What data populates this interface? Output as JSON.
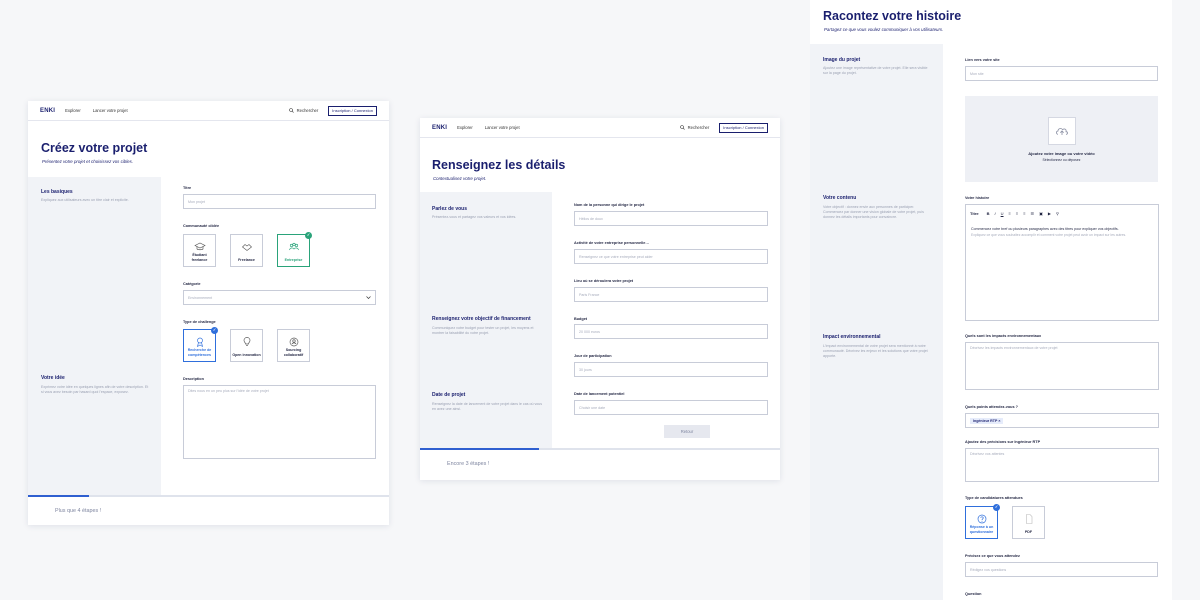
{
  "nav": {
    "logo": "ENKI",
    "explore": "Explorer",
    "launch": "Lancer votre projet",
    "search": "Rechercher",
    "login": "Inscription / Connexion"
  },
  "screen1": {
    "title": "Créez votre projet",
    "subtitle": "Présentez votre projet et choisissez vos cibles.",
    "sections": [
      {
        "title": "Les basiques",
        "desc": "Expliquez aux utilisateurs avec un titre clair et explicite."
      },
      {
        "title": "Votre idée",
        "desc": "Exprimez votre idée en quelques lignes afin de votre description. Et si vous avez besoin par hasard quoi l'espace, exposez."
      }
    ],
    "fields": {
      "titre_label": "Titre",
      "titre_placeholder": "Mon projet",
      "communaute_label": "Communauté ciblée",
      "categorie_label": "Catégorie",
      "categorie_value": "Environnement",
      "challenge_label": "Type de challenge",
      "description_label": "Description",
      "description_placeholder": "Dites nous en un peu plus sur l'idée de votre projet"
    },
    "communities": [
      "Étudiant freelance",
      "Freelance",
      "Entreprise"
    ],
    "challenges": [
      "Recherche de compétences",
      "Open innovation",
      "Sourcing collaboratif"
    ],
    "remaining": "Plus que 4 étapes !",
    "progress": 0.17
  },
  "screen2": {
    "title": "Renseignez les détails",
    "subtitle": "Contextualisez votre projet.",
    "sections": [
      {
        "title": "Parlez de vous",
        "desc": "Présentez-vous et partagez vos valeurs et vos idées."
      },
      {
        "title": "Renseignez votre objectif de financement",
        "desc": "Communiquez votre budget pour tester un projet, les moyens et montrer la faisabilité du votre projet."
      },
      {
        "title": "Date de projet",
        "desc": "Renseignez la date de lancement de votre projet dans le cas où vous en avez une ainsi."
      }
    ],
    "fields": [
      {
        "label": "Nom de la personne qui dirige le projet",
        "placeholder": "Hélios de doux"
      },
      {
        "label": "Activité de votre entreprise personnelle…",
        "placeholder": "Renseignez ce que votre entreprise peut aider"
      },
      {
        "label": "Lieu où se déroulera votre projet",
        "placeholder": "Paris France"
      },
      {
        "label": "Budget",
        "placeholder": "20 000 euros"
      },
      {
        "label": "Jour de participation",
        "placeholder": "30 jours"
      },
      {
        "label": "Date de lancement potentiel",
        "placeholder": "Choisir une date"
      }
    ],
    "button": "Retour",
    "remaining": "Encore 3 étapes !",
    "progress": 0.33
  },
  "screen3": {
    "title": "Racontez votre histoire",
    "subtitle": "Partagez ce que vous voulez communiquer à vos utilisateurs.",
    "sections": [
      {
        "title": "Image du projet",
        "desc": "Ajoutez une image représentative de votre projet. Elle sera visible sur la page du projet."
      },
      {
        "title": "Votre contenu",
        "desc": "Votre objectif : donnez envie aux personnes de participer. Commencez par donner une vision globale de votre projet, puis donnez les détails importants pour convaincre."
      },
      {
        "title": "Impact environnemental",
        "desc": "L'impact environnemental de votre projet sera mentionné à notre communauté. Décrivez les enjeux et les solutions que votre projet apporte."
      }
    ],
    "link_label": "Lien vers votre site",
    "link_placeholder": "Mon site",
    "dropzone_title": "Ajoutez votre image ou votre vidéo",
    "dropzone_sub": "Sélectionnez ou déposez",
    "history_label": "Votre histoire",
    "toolbar_title": "Titre",
    "editor_text": "Commencez votre bref ou plusieurs paragraphes avec des titres pour expliquer vos objectifs.",
    "editor_sub": "Expliquez ce que vous souhaitez accomplir et comment votre projet peut avoir un impact sur les autres.",
    "impact_label": "Quels sont les impacts environnementaux",
    "impact_placeholder": "Décrivez les impacts environnementaux de votre projet",
    "points_label": "Quels points attendez-vous ?",
    "tag": "Ingénieur RTP",
    "precision_label": "Ajoutez des précisions sur Ingénieur RTP",
    "precision_placeholder": "Décrivez vos attentes",
    "candidature_label": "Type de candidatures attendues",
    "candidatures": [
      "Réponse à un questionnaire",
      "PDF"
    ],
    "precisez_label": "Précisez ce que vous attendez",
    "precisez_placeholder": "Rédigez vos questions",
    "questions_label": "Question"
  }
}
